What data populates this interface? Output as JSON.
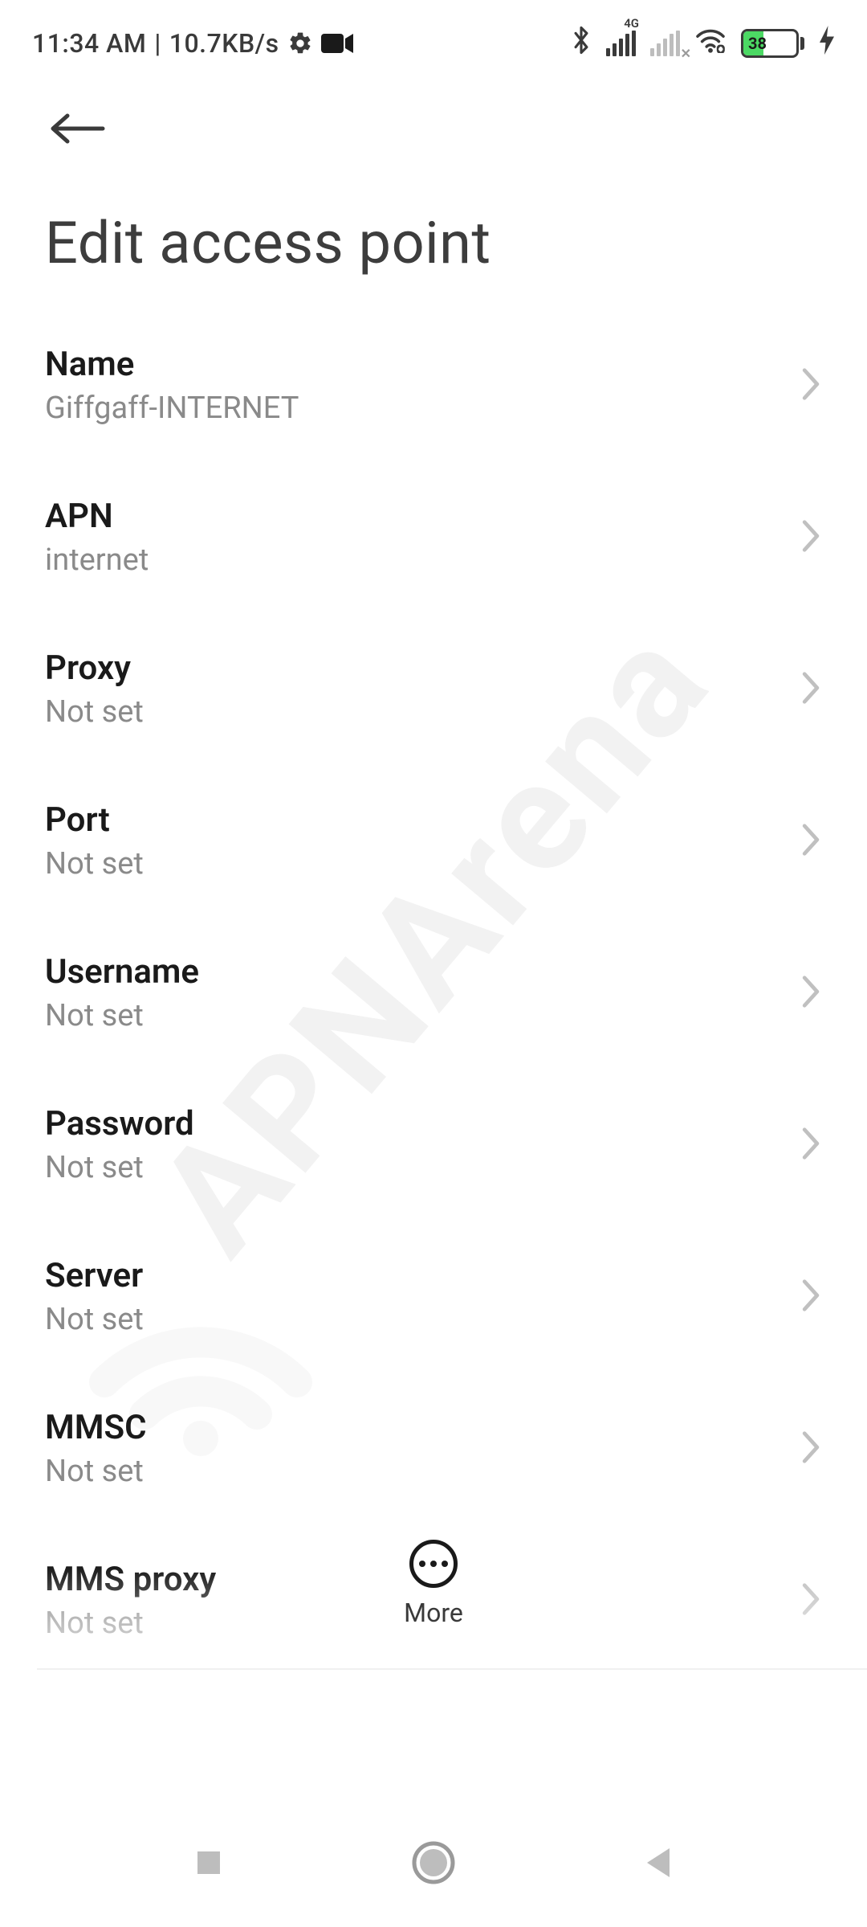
{
  "status": {
    "time": "11:34 AM",
    "separator": "|",
    "speed": "10.7KB/s",
    "network_label": "4G",
    "battery_percent": "38"
  },
  "header": {
    "title": "Edit access point"
  },
  "items": [
    {
      "label": "Name",
      "value": "Giffgaff-INTERNET"
    },
    {
      "label": "APN",
      "value": "internet"
    },
    {
      "label": "Proxy",
      "value": "Not set"
    },
    {
      "label": "Port",
      "value": "Not set"
    },
    {
      "label": "Username",
      "value": "Not set"
    },
    {
      "label": "Password",
      "value": "Not set"
    },
    {
      "label": "Server",
      "value": "Not set"
    },
    {
      "label": "MMSC",
      "value": "Not set"
    },
    {
      "label": "MMS proxy",
      "value": "Not set"
    }
  ],
  "bottom": {
    "more_label": "More"
  },
  "watermark": {
    "text": "APNArena"
  }
}
